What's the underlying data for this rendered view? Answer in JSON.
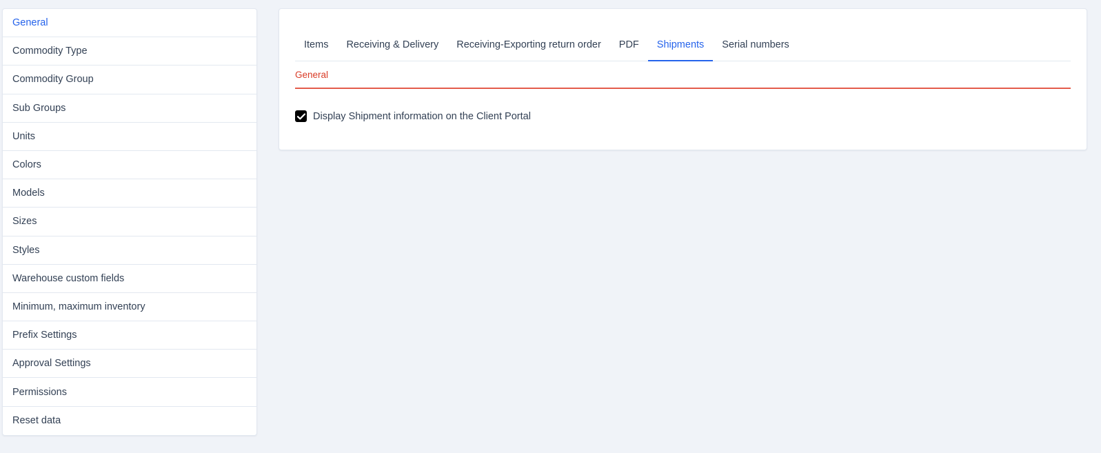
{
  "sidebar": {
    "items": [
      {
        "label": "General",
        "active": true
      },
      {
        "label": "Commodity Type"
      },
      {
        "label": "Commodity Group"
      },
      {
        "label": "Sub Groups"
      },
      {
        "label": "Units"
      },
      {
        "label": "Colors"
      },
      {
        "label": "Models"
      },
      {
        "label": "Sizes"
      },
      {
        "label": "Styles"
      },
      {
        "label": "Warehouse custom fields"
      },
      {
        "label": "Minimum, maximum inventory"
      },
      {
        "label": "Prefix Settings"
      },
      {
        "label": "Approval Settings"
      },
      {
        "label": "Permissions"
      },
      {
        "label": "Reset data"
      }
    ]
  },
  "tabs": [
    {
      "label": "Items"
    },
    {
      "label": "Receiving & Delivery"
    },
    {
      "label": "Receiving-Exporting return order"
    },
    {
      "label": "PDF"
    },
    {
      "label": "Shipments",
      "active": true
    },
    {
      "label": "Serial numbers"
    }
  ],
  "section": {
    "title": "General"
  },
  "settings": {
    "display_shipment_label": "Display Shipment information on the Client Portal",
    "display_shipment_checked": true
  },
  "colors": {
    "accent": "#2563eb",
    "section_accent": "#d93b26",
    "background": "#f0f3f8"
  }
}
